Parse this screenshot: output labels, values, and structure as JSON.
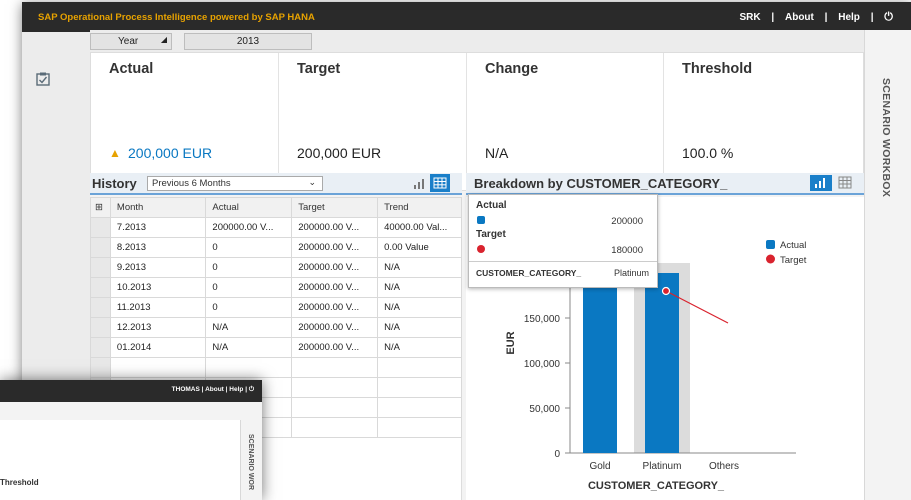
{
  "app": {
    "title": "SAP Operational Process Intelligence powered by SAP HANA",
    "user": "SRK",
    "about": "About",
    "help": "Help",
    "sep": "|"
  },
  "filters": {
    "year_label": "Year",
    "year_value": "2013"
  },
  "kpi": {
    "actual_label": "Actual",
    "actual_value": "200,000 EUR",
    "target_label": "Target",
    "target_value": "200,000 EUR",
    "change_label": "Change",
    "change_value": "N/A",
    "threshold_label": "Threshold",
    "threshold_value": "100.0 %"
  },
  "history": {
    "title": "History",
    "period": "Previous 6 Months",
    "columns": [
      "Month",
      "Actual",
      "Target",
      "Trend"
    ],
    "rows": [
      [
        "7.2013",
        "200000.00 V...",
        "200000.00 V...",
        "40000.00 Val..."
      ],
      [
        "8.2013",
        "0",
        "200000.00 V...",
        "0.00 Value"
      ],
      [
        "9.2013",
        "0",
        "200000.00 V...",
        "N/A"
      ],
      [
        "10.2013",
        "0",
        "200000.00 V...",
        "N/A"
      ],
      [
        "11.2013",
        "0",
        "200000.00 V...",
        "N/A"
      ],
      [
        "12.2013",
        "N/A",
        "200000.00 V...",
        "N/A"
      ],
      [
        "01.2014",
        "N/A",
        "200000.00 V...",
        "N/A"
      ]
    ]
  },
  "breakdown": {
    "title": "Breakdown by CUSTOMER_CATEGORY_"
  },
  "tooltip": {
    "actual_label": "Actual",
    "actual_value": "200000",
    "target_label": "Target",
    "target_value": "180000",
    "dim_label": "CUSTOMER_CATEGORY_",
    "dim_value": "Platinum"
  },
  "right_panel": {
    "label": "SCENARIO WORKBOX"
  },
  "second_window": {
    "user": "THOMAS",
    "about": "About",
    "help": "Help",
    "threshold_label": "Threshold",
    "side_label": "SCENARIO WOR"
  },
  "colors": {
    "accent": "#e7a200",
    "bar": "#0a78c2",
    "target": "#d9232e",
    "topbar": "#2a2a2a"
  },
  "chart_data": {
    "type": "bar",
    "categories": [
      "Gold",
      "Platinum",
      "Others"
    ],
    "series": [
      {
        "name": "Actual",
        "values": [
          200000,
          200000,
          0
        ]
      },
      {
        "name": "Target",
        "values": [
          null,
          180000,
          null
        ]
      }
    ],
    "xlabel": "CUSTOMER_CATEGORY_",
    "ylabel": "EUR",
    "yticks": [
      "0",
      "50,000",
      "100,000",
      "150,000"
    ],
    "ylim": [
      0,
      200000
    ],
    "legend": "top-right"
  }
}
